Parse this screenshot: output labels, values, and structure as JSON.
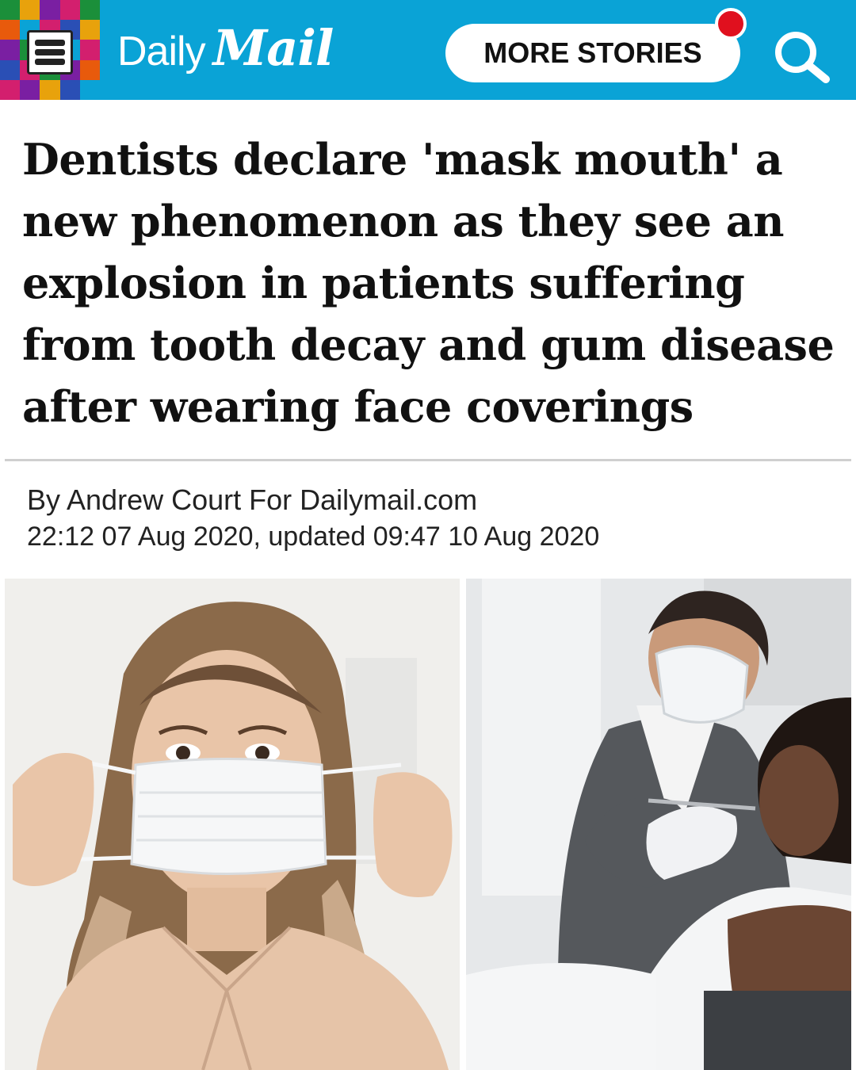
{
  "header": {
    "brand_daily": "Daily",
    "brand_mail": "Mail",
    "more_stories_label": "MORE STORIES",
    "background_color": "#0aa3d6",
    "notification_color": "#e0101e",
    "menu_icon": "hamburger-menu-icon",
    "search_icon": "search-icon"
  },
  "article": {
    "headline": "Dentists declare 'mask mouth' a new phenomenon as they see an explosion in patients suffering from tooth decay and gum disease after wearing face coverings",
    "byline": "By Andrew Court For Dailymail.com",
    "timestamp": "22:12 07 Aug 2020, updated 09:47 10 Aug 2020"
  },
  "images": {
    "left": "woman-with-face-mask-photo",
    "right": "dentist-with-patient-photo"
  }
}
